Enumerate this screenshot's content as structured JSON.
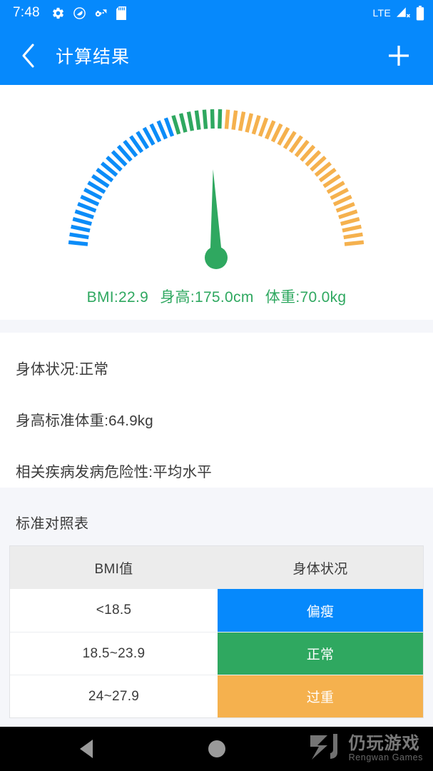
{
  "statusbar": {
    "time": "7:48",
    "network": "LTE",
    "icons": [
      "gear-icon",
      "do-not-disturb-icon",
      "gear-wifi-icon",
      "sd-card-icon"
    ],
    "right_icons": [
      "signal-no-service-icon",
      "battery-full-icon"
    ]
  },
  "appbar": {
    "back_label": "‹",
    "title": "计算结果",
    "add_label": "+"
  },
  "gauge": {
    "needle_value": 22.9,
    "readout_bmi": "BMI:22.9",
    "readout_height": "身高:175.0cm",
    "readout_weight": "体重:70.0kg",
    "colors": {
      "blue": "#0b8cf8",
      "green": "#2fa860",
      "orange": "#f5b14e"
    }
  },
  "info": {
    "line1": "身体状况:正常",
    "line2": "身高标准体重:64.9kg",
    "line3": "相关疾病发病危险性:平均水平"
  },
  "table": {
    "title": "标准对照表",
    "headers": [
      "BMI值",
      "身体状况"
    ],
    "rows": [
      {
        "range": "<18.5",
        "status": "偏瘦",
        "color": "#0689fc"
      },
      {
        "range": "18.5~23.9",
        "status": "正常",
        "color": "#2fa860"
      },
      {
        "range": "24~27.9",
        "status": "过重",
        "color": "#f5b14e"
      }
    ]
  },
  "navbar": {
    "back": "nav-back-icon",
    "home": "nav-home-icon"
  },
  "watermark": {
    "cn": "仍玩游戏",
    "en": "Rengwan Games"
  },
  "chart_data": {
    "type": "gauge",
    "title": "BMI Gauge",
    "value": 22.9,
    "range": [
      10,
      40
    ],
    "needle_angle_deg": -2,
    "bands": [
      {
        "name": "偏瘦",
        "color": "#0b8cf8",
        "ticks": 22
      },
      {
        "name": "正常",
        "color": "#2fa860",
        "ticks": 7
      },
      {
        "name": "过重",
        "color": "#f5b14e",
        "ticks": 27
      }
    ],
    "total_ticks": 56
  }
}
